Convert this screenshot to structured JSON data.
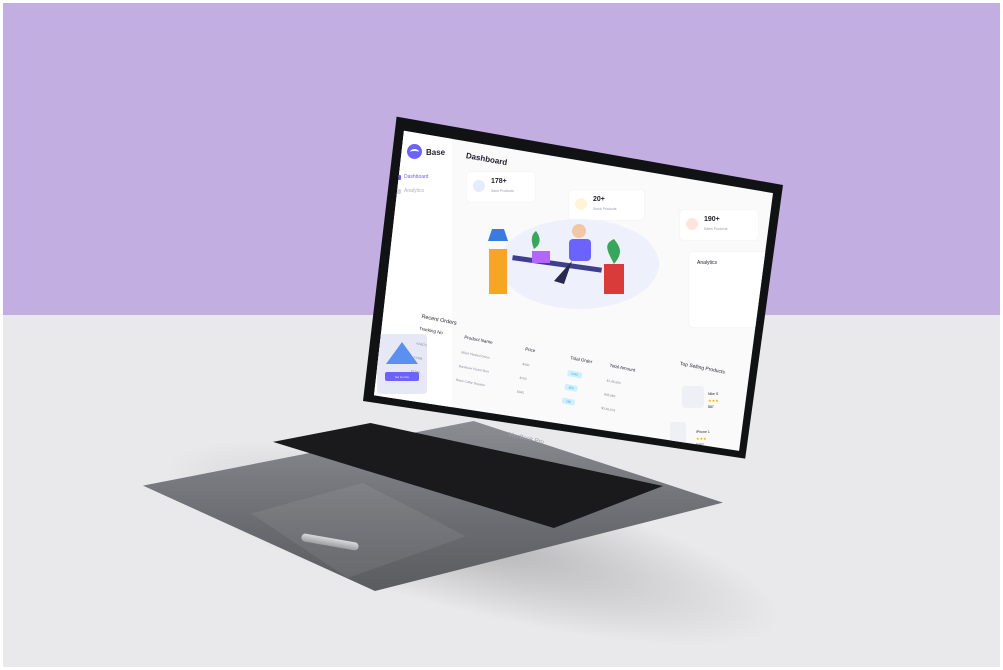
{
  "app": {
    "name": "Base",
    "page_title": "Dashboard"
  },
  "sidebar": {
    "items": [
      {
        "label": "Dashboard",
        "icon": "grid-icon",
        "active": true
      },
      {
        "label": "Analytics",
        "icon": "chart-icon",
        "active": false
      }
    ],
    "promo_button": "Go to now"
  },
  "stats": [
    {
      "value": "178+",
      "label": "Save Products",
      "icon": "shield-icon",
      "color": "#6c8cff"
    },
    {
      "value": "20+",
      "label": "Stock Products",
      "icon": "box-icon",
      "color": "#f5c542"
    },
    {
      "value": "190+",
      "label": "Sales Products",
      "icon": "bag-icon",
      "color": "#ff8a65"
    }
  ],
  "analytics": {
    "label": "Analytics"
  },
  "recent_orders": {
    "title": "Recent Orders",
    "columns": [
      "Tracking No",
      "Product Name",
      "Price",
      "Total Order",
      "Total Amount"
    ],
    "rows": [
      {
        "tracking": "#24579",
        "product": "Black Pleated Dress",
        "price": "$400",
        "orders": "5249",
        "amount": "$1,46,660"
      },
      {
        "tracking": "#1456",
        "product": "Bordeaux Pencil Skirt",
        "price": "$700",
        "orders": "500",
        "amount": "$46,660"
      },
      {
        "tracking": "#1234",
        "product": "Black Collar Sweater",
        "price": "$345",
        "orders": "160",
        "amount": "$3,46,676"
      }
    ]
  },
  "top_selling": {
    "title": "Top Selling Products",
    "items": [
      {
        "name": "Nike S",
        "price": "$87"
      },
      {
        "name": "iPhone 1",
        "price": "$987"
      }
    ]
  },
  "hardware": {
    "model": "MacBook Pro"
  }
}
